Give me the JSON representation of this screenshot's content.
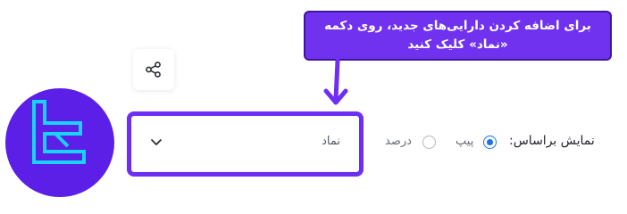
{
  "callout": {
    "line1": "برای اضافه کردن دارایی‌های جدید، روی دکمه",
    "line2": "«نماد» کلیک کنید"
  },
  "filter": {
    "label": "نمایش براساس:",
    "options": [
      {
        "label": "پیپ",
        "selected": true
      },
      {
        "label": "درصد",
        "selected": false
      }
    ]
  },
  "symbol_select": {
    "value": "نماد"
  },
  "icons": {
    "share": "share-icon",
    "chevron": "chevron-down-icon",
    "logo": "brand-logo"
  },
  "colors": {
    "accent": "#7132f0",
    "logo_bg": "#5b1fe8",
    "logo_fg": "#19d3ff",
    "radio_selected": "#1a73e8"
  }
}
